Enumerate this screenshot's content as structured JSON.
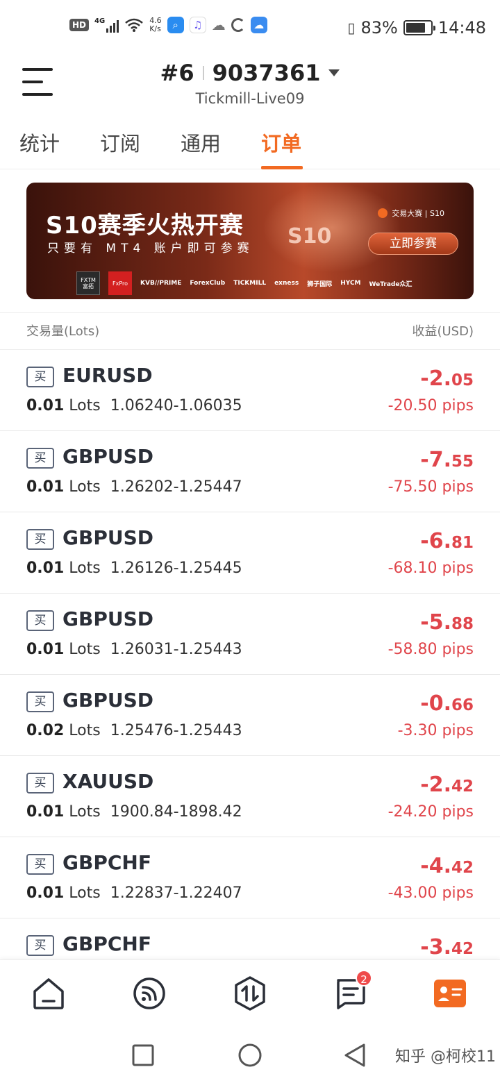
{
  "status_bar": {
    "network_chip": "HD",
    "net_type": "4G",
    "net_speed_value": "4.6",
    "net_speed_unit": "K/s",
    "battery_percent": "83%",
    "battery_level": 0.83,
    "time": "14:48"
  },
  "header": {
    "account_prefix": "#6",
    "account_number": "9037361",
    "server": "Tickmill-Live09"
  },
  "tabs": [
    {
      "label": "统计",
      "active": false
    },
    {
      "label": "订阅",
      "active": false
    },
    {
      "label": "通用",
      "active": false
    },
    {
      "label": "订单",
      "active": true
    }
  ],
  "banner": {
    "title": "S10赛季火热开赛",
    "subtitle": "只要有 MT4 账户即可参赛",
    "brand": "交易大赛 | S10",
    "cta": "立即参赛",
    "center_mark": "S10",
    "logos": [
      "FXTM 富拓",
      "FxPro",
      "KVB//PRIME",
      "ForexClub",
      "TICKMILL",
      "exness",
      "狮子国际",
      "HYCM",
      "WeTrade众汇"
    ]
  },
  "columns": {
    "left": "交易量(Lots)",
    "right": "收益(USD)"
  },
  "orders": [
    {
      "side": "买",
      "symbol": "EURUSD",
      "lots": "0.01",
      "lots_unit": "Lots",
      "prices": "1.06240-1.06035",
      "profit_main": "-2.",
      "profit_dec": "05",
      "pips": "-20.50 pips"
    },
    {
      "side": "买",
      "symbol": "GBPUSD",
      "lots": "0.01",
      "lots_unit": "Lots",
      "prices": "1.26202-1.25447",
      "profit_main": "-7.",
      "profit_dec": "55",
      "pips": "-75.50 pips"
    },
    {
      "side": "买",
      "symbol": "GBPUSD",
      "lots": "0.01",
      "lots_unit": "Lots",
      "prices": "1.26126-1.25445",
      "profit_main": "-6.",
      "profit_dec": "81",
      "pips": "-68.10 pips"
    },
    {
      "side": "买",
      "symbol": "GBPUSD",
      "lots": "0.01",
      "lots_unit": "Lots",
      "prices": "1.26031-1.25443",
      "profit_main": "-5.",
      "profit_dec": "88",
      "pips": "-58.80 pips"
    },
    {
      "side": "买",
      "symbol": "GBPUSD",
      "lots": "0.02",
      "lots_unit": "Lots",
      "prices": "1.25476-1.25443",
      "profit_main": "-0.",
      "profit_dec": "66",
      "pips": "-3.30 pips"
    },
    {
      "side": "买",
      "symbol": "XAUUSD",
      "lots": "0.01",
      "lots_unit": "Lots",
      "prices": "1900.84-1898.42",
      "profit_main": "-2.",
      "profit_dec": "42",
      "pips": "-24.20 pips"
    },
    {
      "side": "买",
      "symbol": "GBPCHF",
      "lots": "0.01",
      "lots_unit": "Lots",
      "prices": "1.22837-1.22407",
      "profit_main": "-4.",
      "profit_dec": "42",
      "pips": "-43.00 pips"
    },
    {
      "side": "买",
      "symbol": "GBPCHF",
      "lots": "",
      "lots_unit": "",
      "prices": "",
      "profit_main": "-3.",
      "profit_dec": "42",
      "pips": ""
    }
  ],
  "bottom_nav": {
    "items": [
      {
        "icon": "home-icon"
      },
      {
        "icon": "feed-icon"
      },
      {
        "icon": "trade-icon"
      },
      {
        "icon": "message-icon",
        "badge": "2"
      },
      {
        "icon": "account-icon"
      }
    ]
  },
  "watermark": "知乎 @柯校11",
  "colors": {
    "accent": "#f26a22",
    "loss": "#e0454b",
    "badge": "#ef4b4b"
  }
}
